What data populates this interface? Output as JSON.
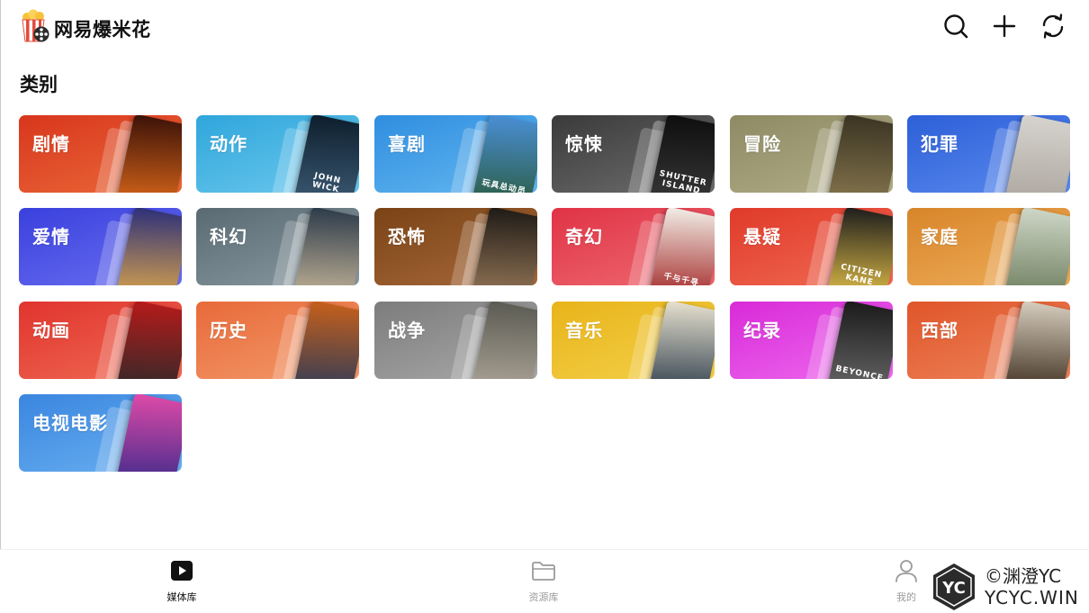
{
  "app": {
    "title": "网易爆米花"
  },
  "section": {
    "title": "类别"
  },
  "categories": [
    {
      "label": "剧情",
      "from": "#d8361c",
      "to": "#ea6a3a",
      "poster_from": "#3a1108",
      "poster_to": "#e06a1a",
      "poster_text": ""
    },
    {
      "label": "动作",
      "from": "#2fa6db",
      "to": "#6dc9ee",
      "poster_from": "#0d1e2c",
      "poster_to": "#3e5d78",
      "poster_text": "JOHN WICK"
    },
    {
      "label": "喜剧",
      "from": "#2f8ee0",
      "to": "#65b8f0",
      "poster_from": "#4a8fd8",
      "poster_to": "#2a5a3a",
      "poster_text": "玩具总动员"
    },
    {
      "label": "惊悚",
      "from": "#3a3a3a",
      "to": "#6e6e6e",
      "poster_from": "#0e0e0e",
      "poster_to": "#3a3a3a",
      "poster_text": "SHUTTER ISLAND"
    },
    {
      "label": "冒险",
      "from": "#8d8a64",
      "to": "#b3ae88",
      "poster_from": "#3a3322",
      "poster_to": "#8a7a50",
      "poster_text": ""
    },
    {
      "label": "犯罪",
      "from": "#2d5fd8",
      "to": "#5a8bee",
      "poster_from": "#d7d4cf",
      "poster_to": "#a9a39b",
      "poster_text": ""
    },
    {
      "label": "爱情",
      "from": "#3a40dd",
      "to": "#6a6ff0",
      "poster_from": "#2b2f7a",
      "poster_to": "#e0a84a",
      "poster_text": ""
    },
    {
      "label": "科幻",
      "from": "#5a6a72",
      "to": "#8a9aa2",
      "poster_from": "#2b3a4a",
      "poster_to": "#c9b89a",
      "poster_text": ""
    },
    {
      "label": "恐怖",
      "from": "#7a4416",
      "to": "#a8683a",
      "poster_from": "#1e1a16",
      "poster_to": "#9a7a5a",
      "poster_text": ""
    },
    {
      "label": "奇幻",
      "from": "#e03345",
      "to": "#ee6a72",
      "poster_from": "#f2efe8",
      "poster_to": "#a02020",
      "poster_text": "千与千寻"
    },
    {
      "label": "悬疑",
      "from": "#e03a2a",
      "to": "#f06a52",
      "poster_from": "#1c1c1c",
      "poster_to": "#e8c44a",
      "poster_text": "CITIZEN KANE"
    },
    {
      "label": "家庭",
      "from": "#d8852a",
      "to": "#eeae5a",
      "poster_from": "#cfd8c8",
      "poster_to": "#6a7a5a",
      "poster_text": ""
    },
    {
      "label": "动画",
      "from": "#e0342e",
      "to": "#f06a52",
      "poster_from": "#b81a1a",
      "poster_to": "#2a2a2a",
      "poster_text": ""
    },
    {
      "label": "历史",
      "from": "#e86a3a",
      "to": "#f39a6a",
      "poster_from": "#c8601a",
      "poster_to": "#2a3a5a",
      "poster_text": ""
    },
    {
      "label": "战争",
      "from": "#7c7c7c",
      "to": "#a9a9a9",
      "poster_from": "#5a5a52",
      "poster_to": "#b0a89a",
      "poster_text": ""
    },
    {
      "label": "音乐",
      "from": "#e8b41a",
      "to": "#f4d04a",
      "poster_from": "#e8e2d0",
      "poster_to": "#2a3a4a",
      "poster_text": ""
    },
    {
      "label": "纪录",
      "from": "#d82ad8",
      "to": "#ee6aee",
      "poster_from": "#1a1a1a",
      "poster_to": "#6a6a6a",
      "poster_text": "BEYONCE"
    },
    {
      "label": "西部",
      "from": "#e0552a",
      "to": "#ee845a",
      "poster_from": "#d8cfc0",
      "poster_to": "#3a2a1a",
      "poster_text": ""
    },
    {
      "label": "电视电影",
      "from": "#3a86e0",
      "to": "#6ab0f0",
      "poster_from": "#e04aa8",
      "poster_to": "#3a2a8a",
      "poster_text": ""
    }
  ],
  "nav": {
    "media_library": "媒体库",
    "resource_library": "资源库",
    "mine": "我的"
  },
  "watermark": {
    "badge": "YC",
    "line1": "©渊澄YC",
    "line2": "YCYC.WIN"
  },
  "icons": {
    "search": "search-icon",
    "add": "plus-icon",
    "refresh": "refresh-icon",
    "media": "play-icon",
    "resource": "folder-icon",
    "mine": "user-icon"
  }
}
